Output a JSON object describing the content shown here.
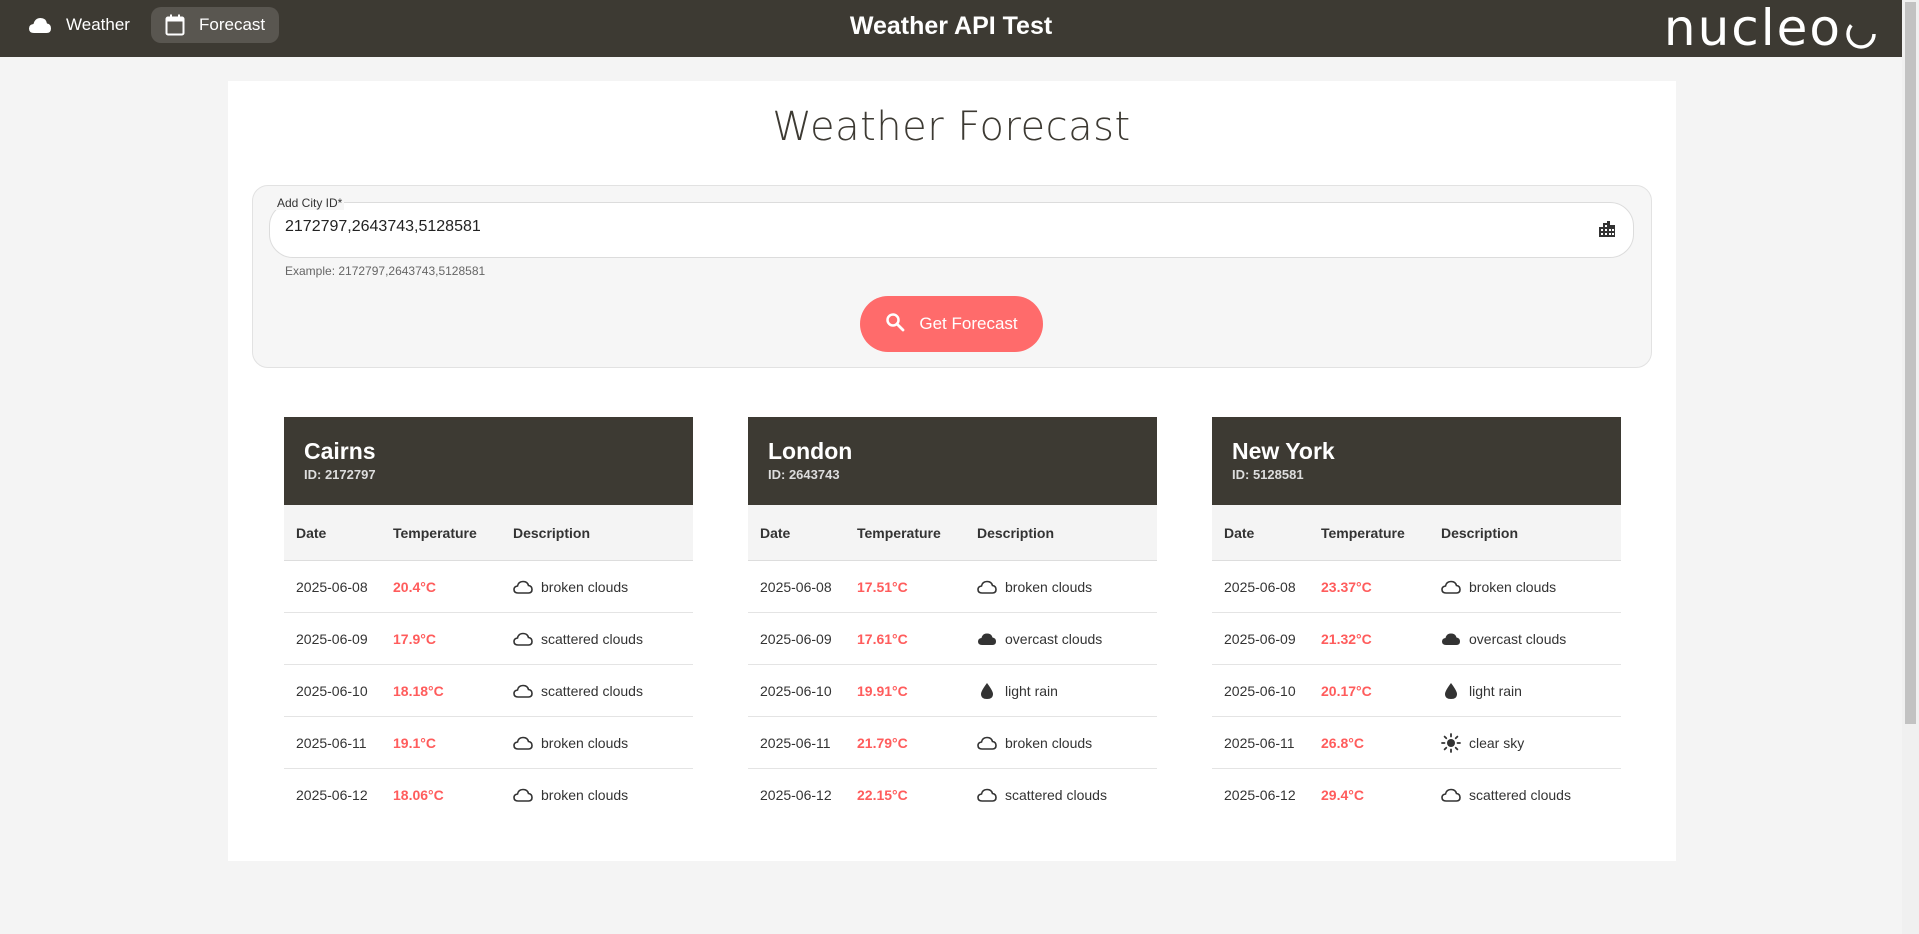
{
  "nav": {
    "weather_label": "Weather",
    "forecast_label": "Forecast"
  },
  "header": {
    "title": "Weather API Test",
    "logo_text": "nucleo"
  },
  "main": {
    "title": "Weather Forecast",
    "field_label": "Add City ID*",
    "field_value": "2172797,2643743,5128581",
    "field_hint": "Example: 2172797,2643743,5128581",
    "button_label": "Get Forecast"
  },
  "table_headers": {
    "date": "Date",
    "temperature": "Temperature",
    "description": "Description"
  },
  "colors": {
    "header_bg": "#3d3a33",
    "accent": "#ff6b6b",
    "temperature": "#ff5c5c"
  },
  "cities": [
    {
      "name": "Cairns",
      "id_label": "ID: 2172797",
      "rows": [
        {
          "date": "2025-06-08",
          "temp": "20.4°C",
          "desc": "broken clouds",
          "icon": "cloud-outline-icon"
        },
        {
          "date": "2025-06-09",
          "temp": "17.9°C",
          "desc": "scattered clouds",
          "icon": "cloud-outline-icon"
        },
        {
          "date": "2025-06-10",
          "temp": "18.18°C",
          "desc": "scattered clouds",
          "icon": "cloud-outline-icon"
        },
        {
          "date": "2025-06-11",
          "temp": "19.1°C",
          "desc": "broken clouds",
          "icon": "cloud-outline-icon"
        },
        {
          "date": "2025-06-12",
          "temp": "18.06°C",
          "desc": "broken clouds",
          "icon": "cloud-outline-icon"
        }
      ]
    },
    {
      "name": "London",
      "id_label": "ID: 2643743",
      "rows": [
        {
          "date": "2025-06-08",
          "temp": "17.51°C",
          "desc": "broken clouds",
          "icon": "cloud-outline-icon"
        },
        {
          "date": "2025-06-09",
          "temp": "17.61°C",
          "desc": "overcast clouds",
          "icon": "cloud-filled-icon"
        },
        {
          "date": "2025-06-10",
          "temp": "19.91°C",
          "desc": "light rain",
          "icon": "rain-drop-icon"
        },
        {
          "date": "2025-06-11",
          "temp": "21.79°C",
          "desc": "broken clouds",
          "icon": "cloud-outline-icon"
        },
        {
          "date": "2025-06-12",
          "temp": "22.15°C",
          "desc": "scattered clouds",
          "icon": "cloud-outline-icon"
        }
      ]
    },
    {
      "name": "New York",
      "id_label": "ID: 5128581",
      "rows": [
        {
          "date": "2025-06-08",
          "temp": "23.37°C",
          "desc": "broken clouds",
          "icon": "cloud-outline-icon"
        },
        {
          "date": "2025-06-09",
          "temp": "21.32°C",
          "desc": "overcast clouds",
          "icon": "cloud-filled-icon"
        },
        {
          "date": "2025-06-10",
          "temp": "20.17°C",
          "desc": "light rain",
          "icon": "rain-drop-icon"
        },
        {
          "date": "2025-06-11",
          "temp": "26.8°C",
          "desc": "clear sky",
          "icon": "sun-icon"
        },
        {
          "date": "2025-06-12",
          "temp": "29.4°C",
          "desc": "scattered clouds",
          "icon": "cloud-outline-icon"
        }
      ]
    }
  ]
}
